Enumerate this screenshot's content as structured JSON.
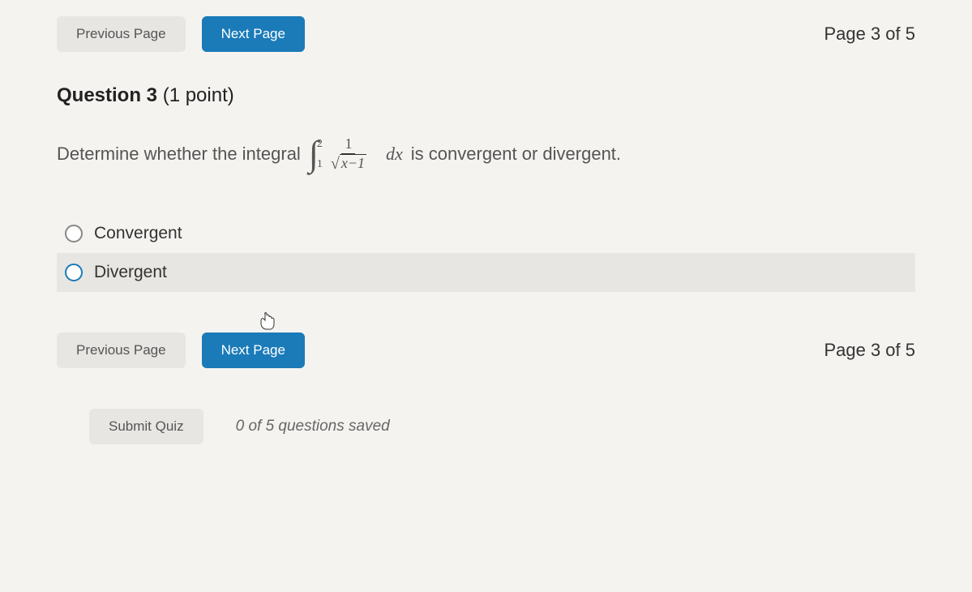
{
  "nav": {
    "prev_label": "Previous Page",
    "next_label": "Next Page",
    "page_indicator": "Page 3 of 5"
  },
  "question": {
    "number_label": "Question 3",
    "points_label": "(1 point)",
    "prompt_before": "Determine whether the integral",
    "integral": {
      "upper": "2",
      "lower": "1",
      "numerator": "1",
      "sqrt_arg": "x−1"
    },
    "dx": "dx",
    "prompt_after": "is convergent or divergent."
  },
  "options": [
    {
      "label": "Convergent",
      "highlighted": false,
      "active": false
    },
    {
      "label": "Divergent",
      "highlighted": true,
      "active": true
    }
  ],
  "submit": {
    "button_label": "Submit Quiz",
    "status": "0 of 5 questions saved"
  }
}
